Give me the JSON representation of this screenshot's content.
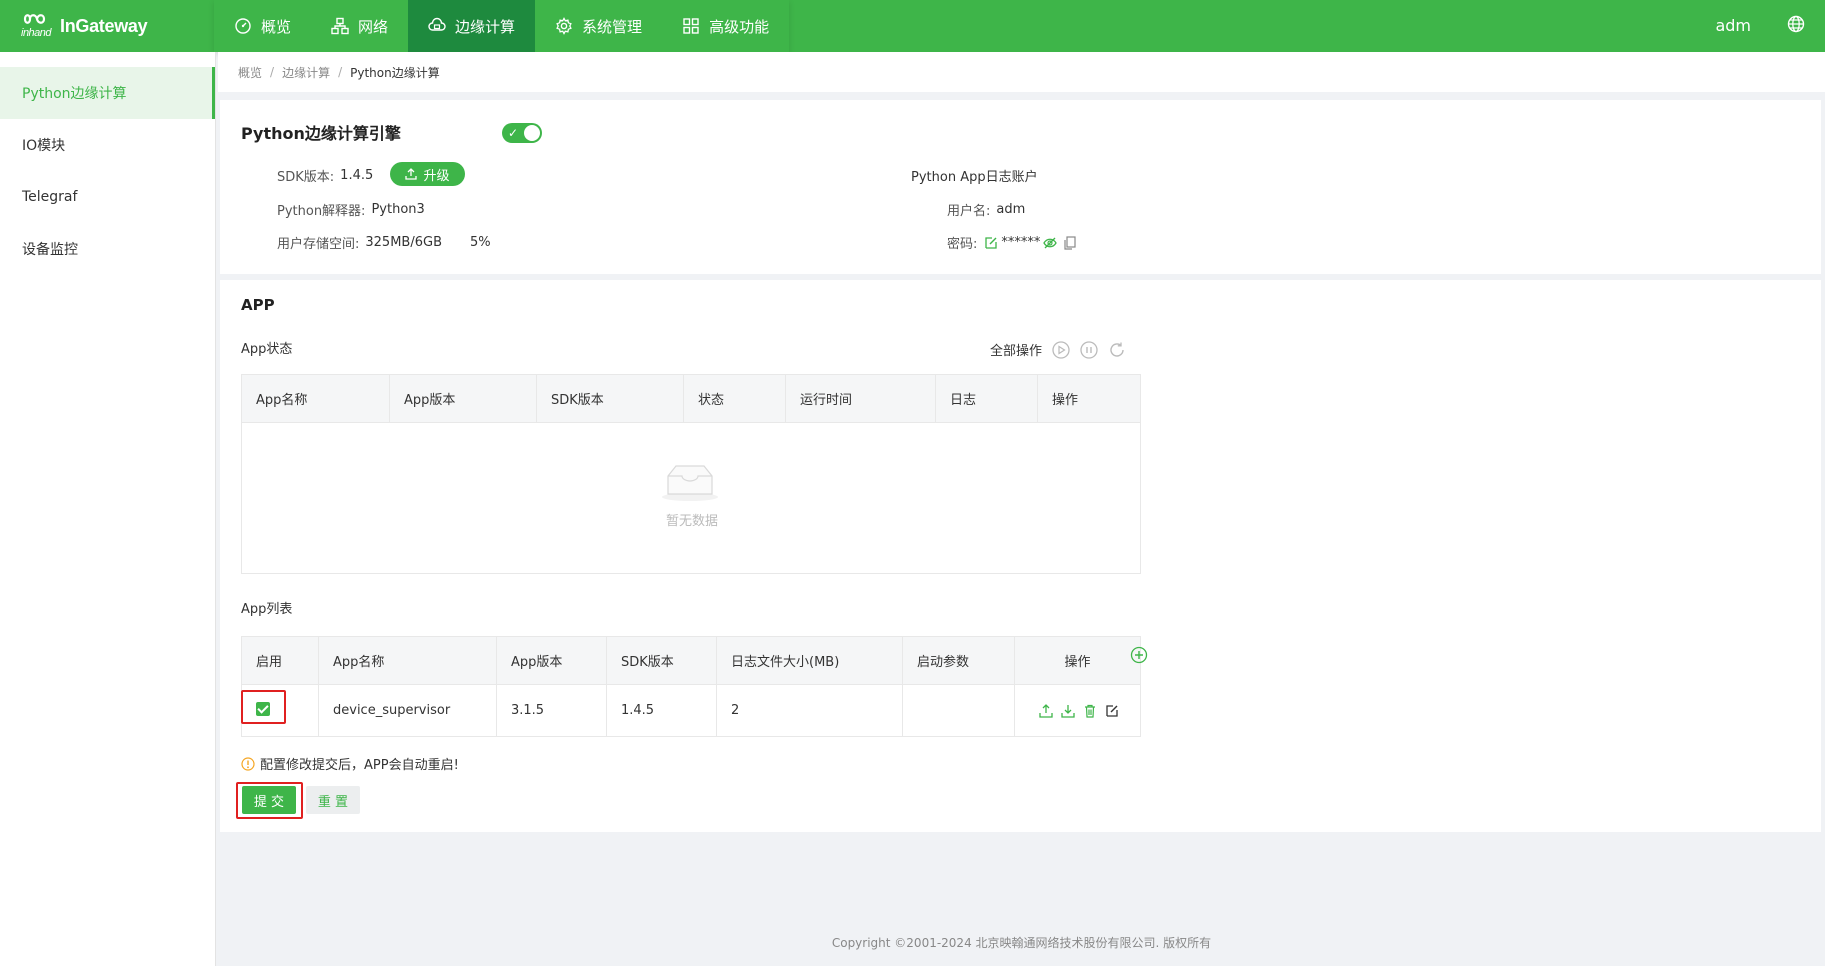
{
  "header": {
    "logo_mark": "inhand",
    "logo_text": "InGateway",
    "nav": [
      {
        "label": "概览",
        "icon": "dashboard-icon"
      },
      {
        "label": "网络",
        "icon": "network-icon"
      },
      {
        "label": "边缘计算",
        "icon": "cloud-icon"
      },
      {
        "label": "系统管理",
        "icon": "gear-icon"
      },
      {
        "label": "高级功能",
        "icon": "grid-icon"
      }
    ],
    "active_nav": "边缘计算",
    "user": "adm"
  },
  "sidebar": {
    "items": [
      {
        "label": "Python边缘计算"
      },
      {
        "label": "IO模块"
      },
      {
        "label": "Telegraf"
      },
      {
        "label": "设备监控"
      }
    ],
    "active": "Python边缘计算"
  },
  "breadcrumb": [
    "概览",
    "边缘计算",
    "Python边缘计算"
  ],
  "engine": {
    "title": "Python边缘计算引擎",
    "enabled": true,
    "sdk_label": "SDK版本:",
    "sdk_value": "1.4.5",
    "upgrade_label": "升级",
    "interpreter_label": "Python解释器:",
    "interpreter_value": "Python3",
    "storage_label": "用户存储空间:",
    "storage_value": "325MB/6GB",
    "storage_percent": "5%",
    "log_account_title": "Python App日志账户",
    "username_label": "用户名:",
    "username_value": "adm",
    "password_label": "密码:",
    "password_value": "******"
  },
  "app": {
    "title": "APP",
    "status_label": "App状态",
    "all_ops_label": "全部操作",
    "status_columns": [
      "App名称",
      "App版本",
      "SDK版本",
      "状态",
      "运行时间",
      "日志",
      "操作"
    ],
    "empty_text": "暂无数据",
    "list_label": "App列表",
    "list_columns": [
      "启用",
      "App名称",
      "App版本",
      "SDK版本",
      "日志文件大小(MB)",
      "启动参数",
      "操作"
    ],
    "rows": [
      {
        "enabled": true,
        "name": "device_supervisor",
        "app_version": "3.1.5",
        "sdk_version": "1.4.5",
        "log_size": "2",
        "params": ""
      }
    ],
    "warning": "配置修改提交后，APP会自动重启!",
    "submit_label": "提 交",
    "reset_label": "重 置"
  },
  "footer": "Copyright ©2001-2024 北京映翰通网络技术股份有限公司. 版权所有",
  "colors": {
    "primary": "#3eb549",
    "nav_active": "#1e8a3e",
    "highlight": "#e02020"
  }
}
